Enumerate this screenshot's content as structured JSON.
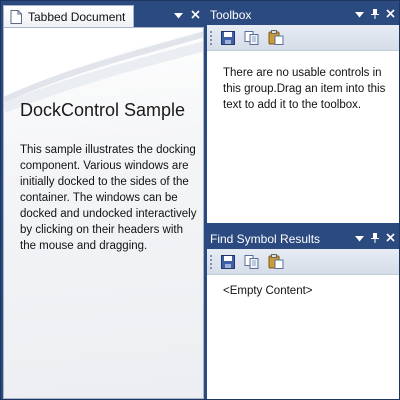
{
  "document": {
    "tab_label": "Tabbed Document",
    "title": "DockControl Sample",
    "body": "This sample illustrates the docking component. Various windows are initially docked to the sides of the container. The windows can be docked and undocked interactively by clicking on their headers with the mouse and dragging."
  },
  "toolbox": {
    "title": "Toolbox",
    "message": "There are no usable controls in this group.Drag an item into this text to add it to the toolbox.",
    "toolbar": [
      "save-icon",
      "copy-icon",
      "paste-icon"
    ]
  },
  "find_symbol": {
    "title": "Find Symbol Results",
    "message": "<Empty Content>",
    "toolbar": [
      "save-icon",
      "copy-icon",
      "paste-icon"
    ]
  },
  "icons": {
    "dropdown": "▼",
    "pin": "⨆",
    "close": "✕"
  },
  "colors": {
    "frame": "#2b4a80",
    "toolbar": "#dfe5ef",
    "content": "#ffffff"
  }
}
